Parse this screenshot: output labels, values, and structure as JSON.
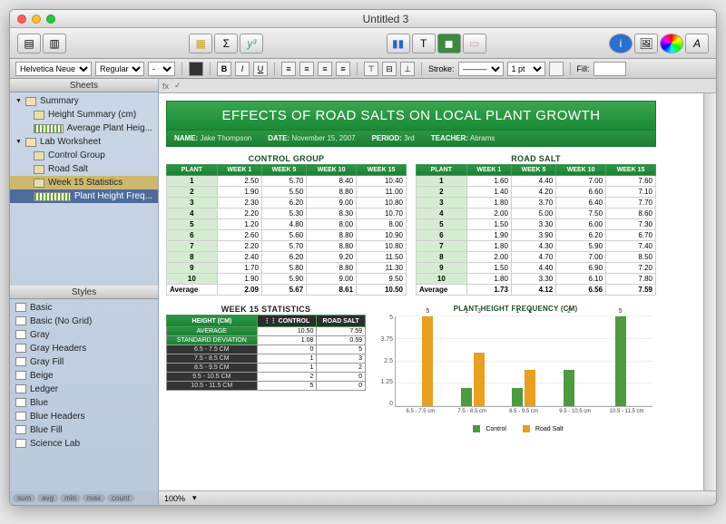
{
  "window": {
    "title": "Untitled 3"
  },
  "format": {
    "font": "Helvetica Neue",
    "weight": "Regular",
    "size": "-",
    "stroke_label": "Stroke:",
    "pt": "1 pt",
    "fill_label": "Fill:"
  },
  "sidebar": {
    "header_sheets": "Sheets",
    "header_styles": "Styles",
    "sheets": [
      {
        "label": "Summary",
        "lev": 1,
        "type": "sheet"
      },
      {
        "label": "Height Summary (cm)",
        "lev": 2,
        "type": "table"
      },
      {
        "label": "Average Plant Heig...",
        "lev": 2,
        "type": "chart"
      },
      {
        "label": "Lab Worksheet",
        "lev": 1,
        "type": "sheet"
      },
      {
        "label": "Control Group",
        "lev": 2,
        "type": "table"
      },
      {
        "label": "Road Salt",
        "lev": 2,
        "type": "table"
      },
      {
        "label": "Week 15 Statistics",
        "lev": 2,
        "type": "table",
        "sel": "sel2"
      },
      {
        "label": "Plant Height Freq...",
        "lev": 2,
        "type": "chart",
        "sel": "sel"
      }
    ],
    "styles": [
      "Basic",
      "Basic (No Grid)",
      "Gray",
      "Gray Headers",
      "Gray Fill",
      "Beige",
      "Ledger",
      "Blue",
      "Blue Headers",
      "Blue Fill",
      "Science Lab"
    ],
    "footer": [
      "sum",
      "avg",
      "min",
      "max",
      "count"
    ]
  },
  "formula": {
    "fx": "fx"
  },
  "doc": {
    "banner": "EFFECTS OF ROAD SALTS ON LOCAL PLANT GROWTH",
    "meta": {
      "name_k": "NAME:",
      "name_v": "Jake Thompson",
      "date_k": "DATE:",
      "date_v": "November 15, 2007",
      "period_k": "PERIOD:",
      "period_v": "3rd",
      "teacher_k": "TEACHER:",
      "teacher_v": "Abrams"
    },
    "control": {
      "title": "CONTROL GROUP",
      "cols": [
        "PLANT",
        "WEEK 1",
        "WEEK 5",
        "WEEK 10",
        "WEEK 15"
      ],
      "rows": [
        [
          "1",
          "2.50",
          "5.70",
          "8.40",
          "10.40"
        ],
        [
          "2",
          "1.90",
          "5.50",
          "8.80",
          "11.00"
        ],
        [
          "3",
          "2.30",
          "6.20",
          "9.00",
          "10.80"
        ],
        [
          "4",
          "2.20",
          "5.30",
          "8.30",
          "10.70"
        ],
        [
          "5",
          "1.20",
          "4.80",
          "8.00",
          "8.00"
        ],
        [
          "6",
          "2.60",
          "5.60",
          "8.80",
          "10.90"
        ],
        [
          "7",
          "2.20",
          "5.70",
          "8.80",
          "10.80"
        ],
        [
          "8",
          "2.40",
          "6.20",
          "9.20",
          "11.50"
        ],
        [
          "9",
          "1.70",
          "5.80",
          "8.80",
          "11.30"
        ],
        [
          "10",
          "1.90",
          "5.90",
          "9.00",
          "9.50"
        ]
      ],
      "avg": [
        "Average",
        "2.09",
        "5.67",
        "8.61",
        "10.50"
      ]
    },
    "roadsalt": {
      "title": "ROAD SALT",
      "cols": [
        "PLANT",
        "WEEK 1",
        "WEEK 5",
        "WEEK 10",
        "WEEK 15"
      ],
      "rows": [
        [
          "1",
          "1.60",
          "4.40",
          "7.00",
          "7.60"
        ],
        [
          "2",
          "1.40",
          "4.20",
          "6.60",
          "7.10"
        ],
        [
          "3",
          "1.80",
          "3.70",
          "6.40",
          "7.70"
        ],
        [
          "4",
          "2.00",
          "5.00",
          "7.50",
          "8.60"
        ],
        [
          "5",
          "1.50",
          "3.30",
          "6.00",
          "7.30"
        ],
        [
          "6",
          "1.90",
          "3.90",
          "6.20",
          "6.70"
        ],
        [
          "7",
          "1.80",
          "4.30",
          "5.90",
          "7.40"
        ],
        [
          "8",
          "2.00",
          "4.70",
          "7.00",
          "8.50"
        ],
        [
          "9",
          "1.50",
          "4.40",
          "6.90",
          "7.20"
        ],
        [
          "10",
          "1.80",
          "3.30",
          "6.10",
          "7.80"
        ]
      ],
      "avg": [
        "Average",
        "1.73",
        "4.12",
        "6.56",
        "7.59"
      ]
    },
    "stats": {
      "title": "WEEK 15 STATISTICS",
      "cols": [
        "HEIGHT (CM)",
        "CONTROL",
        "ROAD SALT"
      ],
      "rows": [
        [
          "AVERAGE",
          "10.50",
          "7.59"
        ],
        [
          "STANDARD DEVIATION",
          "1.08",
          "0.59"
        ],
        [
          "6.5 - 7.5 CM",
          "0",
          "5"
        ],
        [
          "7.5 - 8.5 CM",
          "1",
          "3"
        ],
        [
          "8.5 - 9.5 CM",
          "1",
          "2"
        ],
        [
          "9.5 - 10.5 CM",
          "2",
          "0"
        ],
        [
          "10.5 - 11.5 CM",
          "5",
          "0"
        ]
      ]
    }
  },
  "chart_data": {
    "type": "bar",
    "title": "PLANT HEIGHT FREQUENCY (CM)",
    "categories": [
      "6.5 - 7.5 cm",
      "7.5 - 8.5 cm",
      "8.5 - 9.5 cm",
      "9.5 - 10.5 cm",
      "10.5 - 11.5 cm"
    ],
    "series": [
      {
        "name": "Control",
        "values": [
          0,
          1,
          1,
          2,
          5
        ],
        "color": "#4e9a3e"
      },
      {
        "name": "Road Salt",
        "values": [
          5,
          3,
          2,
          0,
          0
        ],
        "color": "#e8a020"
      }
    ],
    "ylim": [
      0,
      5
    ],
    "yticks": [
      0,
      1.25,
      2.5,
      3.75,
      5
    ]
  },
  "status": {
    "zoom": "100%"
  }
}
